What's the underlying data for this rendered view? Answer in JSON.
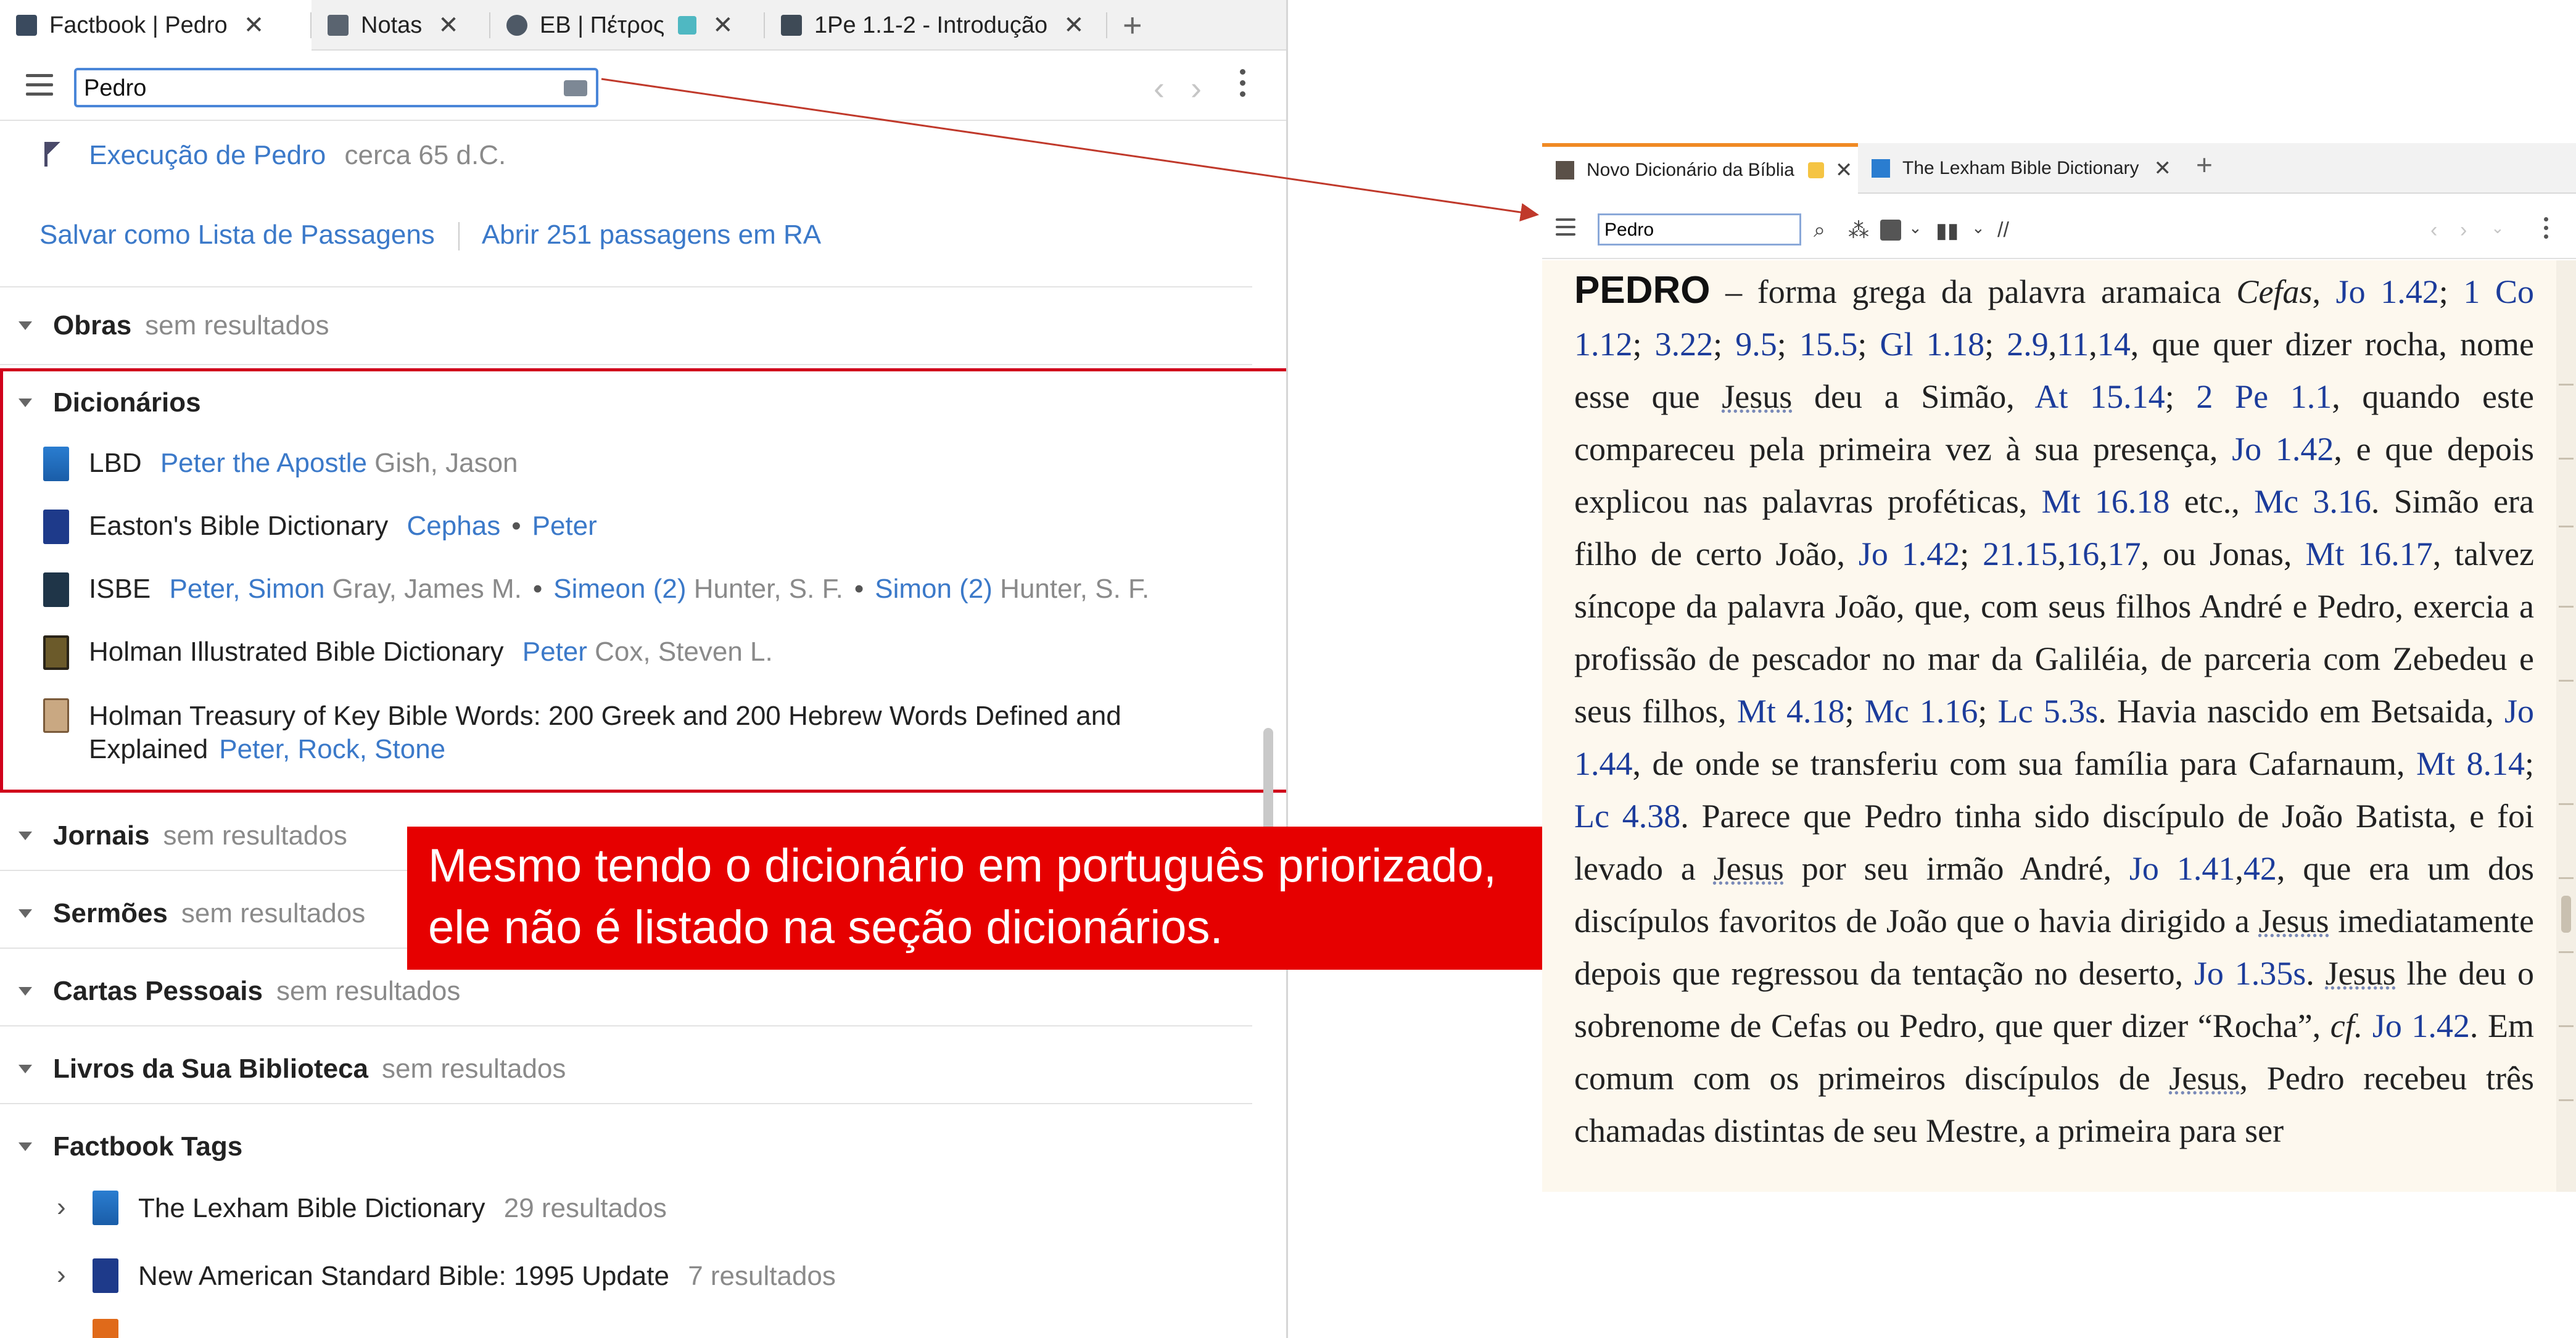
{
  "left": {
    "tabs": [
      {
        "label": "Factbook | Pedro",
        "icon": "factbook-icon"
      },
      {
        "label": "Notas",
        "icon": "notes-icon"
      },
      {
        "label": "EB | Πέτρος",
        "icon": "eb-icon"
      },
      {
        "label": "1Pe 1.1-2 - Introdução",
        "icon": "book-icon"
      }
    ],
    "search_value": "Pedro",
    "event": {
      "label": "Execução de Pedro",
      "date": "cerca 65 d.C."
    },
    "actions": {
      "save": "Salvar como Lista de Passagens",
      "open": "Abrir 251 passagens em RA"
    },
    "obras": {
      "title": "Obras",
      "status": "sem resultados"
    },
    "dicionarios": {
      "title": "Dicionários",
      "entries": [
        {
          "book": "LBD",
          "parts": [
            {
              "text": "Peter the Apostle",
              "link": true
            },
            {
              "text": " Gish, Jason",
              "link": false
            }
          ]
        },
        {
          "book": "Easton's Bible Dictionary",
          "parts": [
            {
              "text": "Cephas",
              "link": true
            },
            {
              "text": "•",
              "link": false
            },
            {
              "text": "Peter",
              "link": true
            }
          ]
        },
        {
          "book": "ISBE",
          "parts": [
            {
              "text": "Peter, Simon",
              "link": true
            },
            {
              "text": " Gray, James M.",
              "link": false
            },
            {
              "text": "•",
              "link": false
            },
            {
              "text": "Simeon (2)",
              "link": true
            },
            {
              "text": " Hunter, S. F.",
              "link": false
            },
            {
              "text": "•",
              "link": false
            },
            {
              "text": "Simon (2)",
              "link": true
            },
            {
              "text": " Hunter, S. F.",
              "link": false
            }
          ]
        },
        {
          "book": "Holman Illustrated Bible Dictionary",
          "parts": [
            {
              "text": "Peter",
              "link": true
            },
            {
              "text": " Cox, Steven L.",
              "link": false
            }
          ]
        },
        {
          "book": "Holman Treasury of Key Bible Words: 200 Greek and 200 Hebrew Words Defined and",
          "book2": "Explained",
          "parts": [
            {
              "text": "Peter, Rock, Stone",
              "link": true
            }
          ]
        }
      ]
    },
    "sections": [
      {
        "title": "Jornais",
        "status": "sem resultados"
      },
      {
        "title": "Sermões",
        "status": "sem resultados"
      },
      {
        "title": "Cartas Pessoais",
        "status": "sem resultados"
      },
      {
        "title": "Livros da Sua Biblioteca",
        "status": "sem resultados"
      },
      {
        "title": "Factbook Tags",
        "status": ""
      }
    ],
    "tags": [
      {
        "book": "The Lexham Bible Dictionary",
        "count": "29 resultados"
      },
      {
        "book": "New American Standard Bible: 1995 Update",
        "count": "7 resultados"
      }
    ]
  },
  "callout": {
    "line1": "Mesmo tendo o dicionário em português priorizado,",
    "line2": "ele não é listado na seção dicionários."
  },
  "right": {
    "tabs": [
      {
        "label": "Novo Dicionário da Bíblia"
      },
      {
        "label": "The Lexham Bible Dictionary"
      }
    ],
    "search_value": "Pedro",
    "headword": "PEDRO"
  },
  "colors": {
    "accent": "#3b79c9",
    "highlight": "#d0021b",
    "callout": "#e60000",
    "article_bg": "#fdf8ee",
    "ref": "#1c3c9b"
  }
}
